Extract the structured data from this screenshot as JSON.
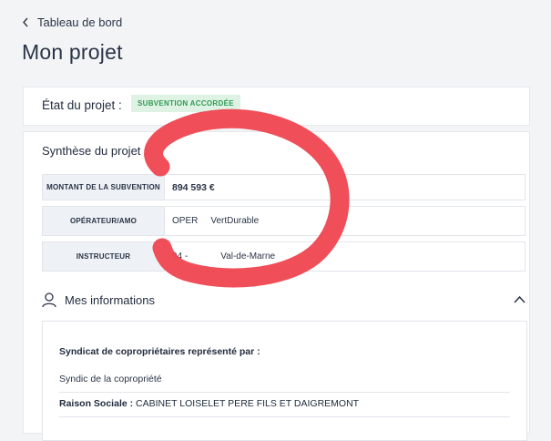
{
  "breadcrumb": {
    "back_label": "Tableau de bord"
  },
  "page": {
    "title": "Mon projet"
  },
  "status": {
    "label": "État du projet :",
    "badge": "SUBVENTION ACCORDÉE",
    "badge_color": "#2e9a54",
    "badge_bg": "#dff3e4"
  },
  "synthese": {
    "title": "Synthèse du projet :",
    "rows": [
      {
        "key": "MONTANT DE LA SUBVENTION",
        "value": "894 593 €"
      },
      {
        "key": "OPÉRATEUR/AMO",
        "value_a": "OPER",
        "value_b": "VertDurable"
      },
      {
        "key": "INSTRUCTEUR",
        "value_a": "94 -",
        "value_b": "Val-de-Marne"
      }
    ]
  },
  "mes_informations": {
    "label": "Mes informations",
    "heading": "Syndicat de copropriétaires représenté par :",
    "subtitle": "Syndic de la copropriété",
    "raison_label": "Raison Sociale :",
    "raison_value": "CABINET LOISELET PERE FILS ET DAIGREMONT"
  },
  "icons": {
    "back": "chevron-left-icon",
    "user": "user-icon",
    "collapse": "chevron-up-icon"
  },
  "annotation_color": "#ef4650"
}
